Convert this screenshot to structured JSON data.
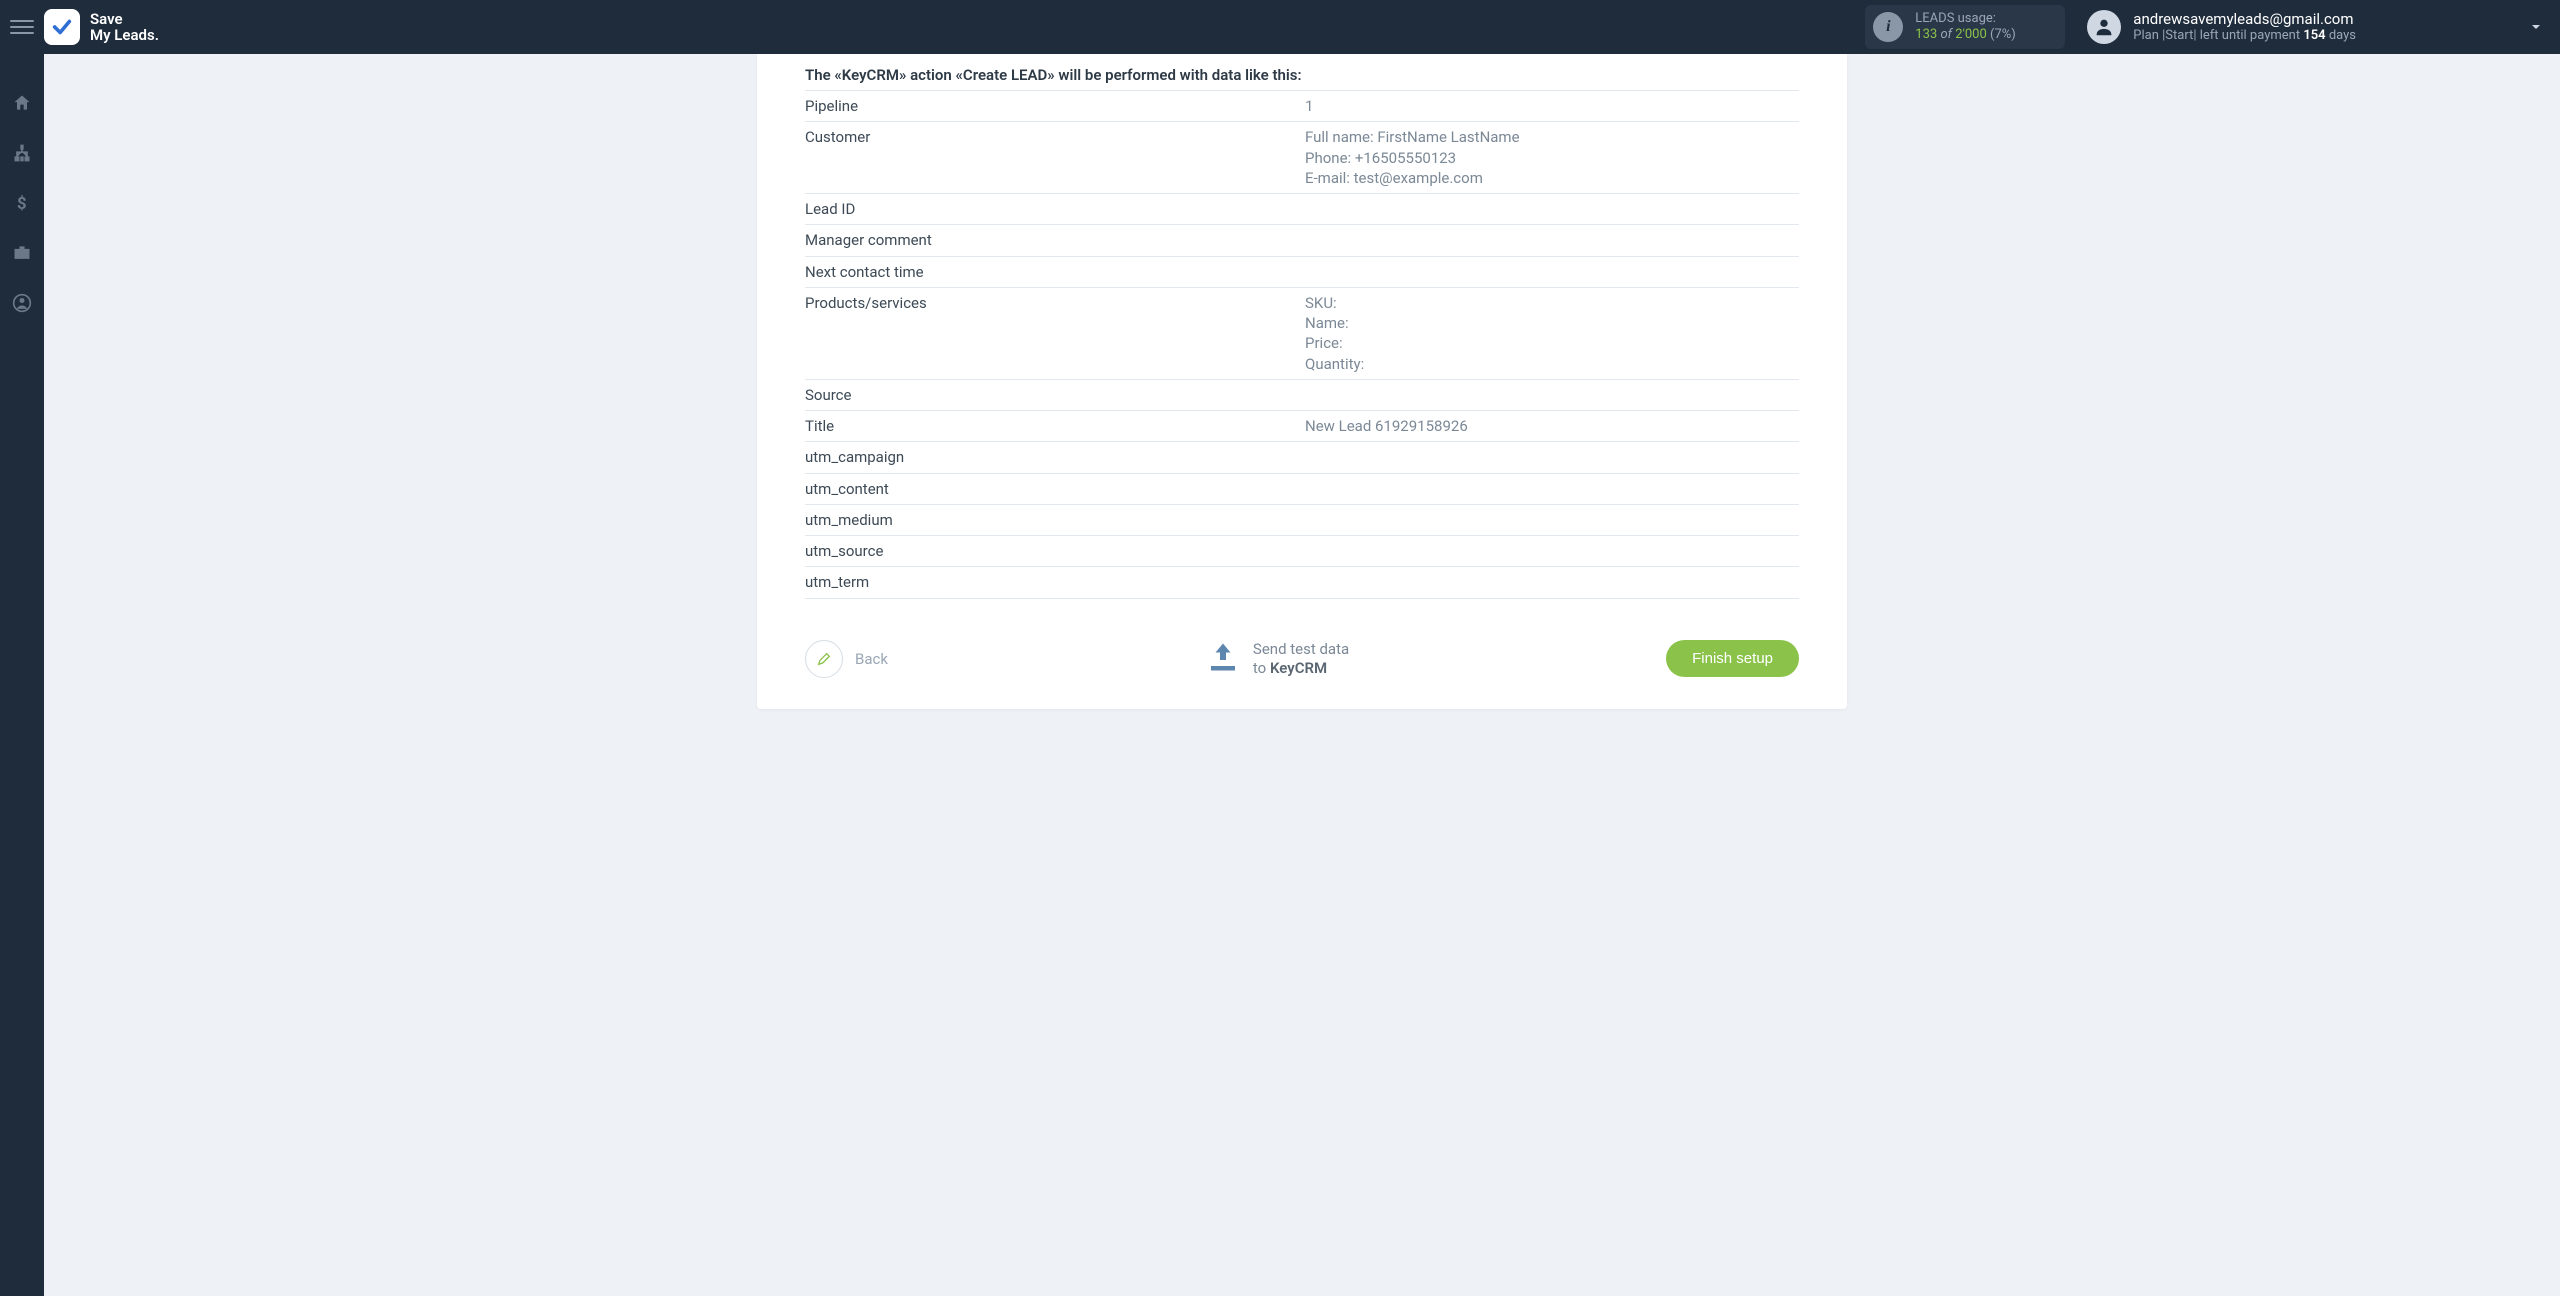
{
  "brand": {
    "line1": "Save",
    "line2": "My Leads."
  },
  "usage": {
    "label": "LEADS usage:",
    "used": "133",
    "of_word": "of",
    "total": "2'000",
    "pct": "(7%)"
  },
  "account": {
    "email": "andrewsavemyleads@gmail.com",
    "plan_prefix": "Plan |Start| left until payment ",
    "days_num": "154",
    "days_suffix": " days"
  },
  "main": {
    "heading": "The «KeyCRM» action «Create LEAD» will be performed with data like this:",
    "rows": [
      {
        "key": "Pipeline",
        "val": "1"
      },
      {
        "key": "Customer",
        "val": "Full name: FirstName LastName\nPhone: +16505550123\nE-mail: test@example.com"
      },
      {
        "key": "Lead ID",
        "val": ""
      },
      {
        "key": "Manager comment",
        "val": ""
      },
      {
        "key": "Next contact time",
        "val": ""
      },
      {
        "key": "Products/services",
        "val": "SKU:\nName:\nPrice:\nQuantity:"
      },
      {
        "key": "Source",
        "val": ""
      },
      {
        "key": "Title",
        "val": "New Lead 61929158926"
      },
      {
        "key": "utm_campaign",
        "val": ""
      },
      {
        "key": "utm_content",
        "val": ""
      },
      {
        "key": "utm_medium",
        "val": ""
      },
      {
        "key": "utm_source",
        "val": ""
      },
      {
        "key": "utm_term",
        "val": ""
      }
    ]
  },
  "footer": {
    "back_label": "Back",
    "send_line1": "Send test data",
    "send_line2_prefix": "to ",
    "send_line2_target": "KeyCRM",
    "finish_label": "Finish setup"
  },
  "icons": {
    "info": "i"
  }
}
